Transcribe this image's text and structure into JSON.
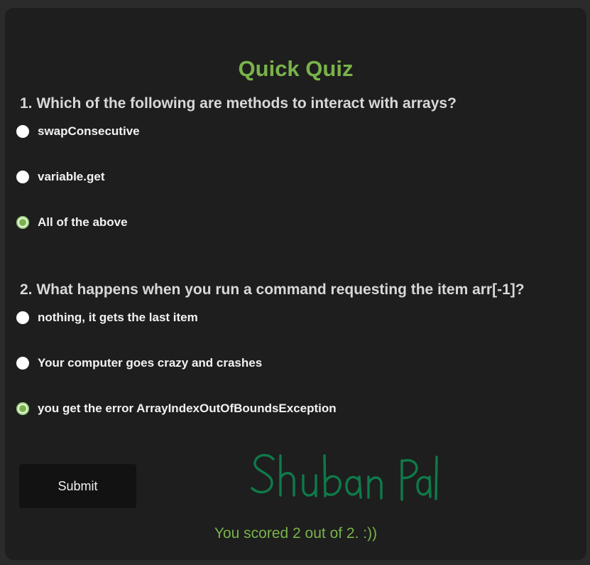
{
  "quiz": {
    "title": "Quick Quiz",
    "questions": [
      {
        "text": "1. Which of the following are methods to interact with arrays?",
        "options": [
          {
            "label": "swapConsecutive",
            "checked": false
          },
          {
            "label": "variable.get",
            "checked": false
          },
          {
            "label": "All of the above",
            "checked": true
          }
        ]
      },
      {
        "text": "2. What happens when you run a command requesting the item arr[-1]?",
        "options": [
          {
            "label": "nothing, it gets the last item",
            "checked": false
          },
          {
            "label": "Your computer goes crazy and crashes",
            "checked": false
          },
          {
            "label": "you get the error ArrayIndexOutOfBoundsException",
            "checked": true
          }
        ]
      }
    ],
    "submit_label": "Submit",
    "signature": "Shuban Pal",
    "score_text": "You scored 2 out of 2. :))"
  },
  "colors": {
    "accent": "#79b24a",
    "signature_ink": "#0f7a4a",
    "card_background": "#1e1e1e",
    "page_background": "#2b2b2b"
  }
}
